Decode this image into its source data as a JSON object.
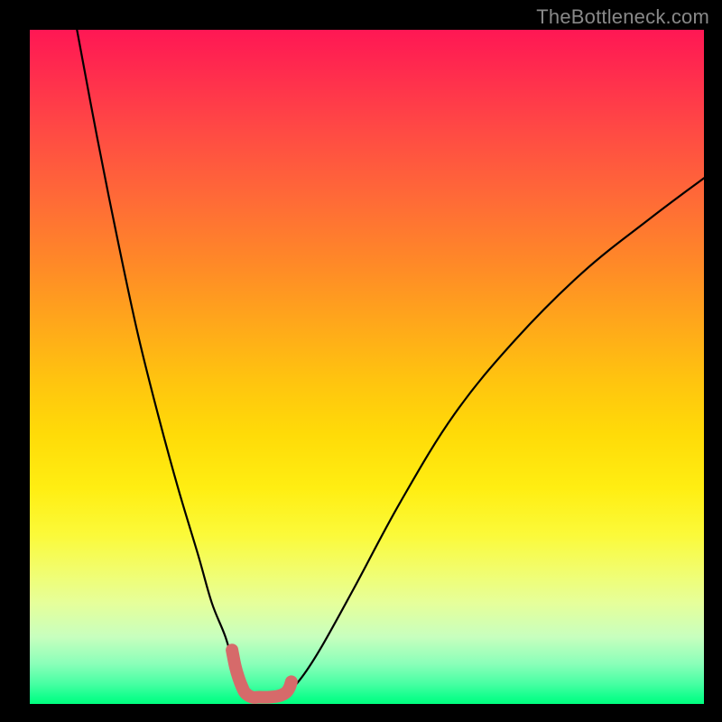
{
  "watermark": "TheBottleneck.com",
  "chart_data": {
    "type": "line",
    "title": "",
    "xlabel": "",
    "ylabel": "",
    "xlim": [
      0,
      100
    ],
    "ylim": [
      0,
      100
    ],
    "series": [
      {
        "name": "bottleneck-curve",
        "x": [
          7,
          10,
          13,
          16,
          19,
          22,
          25,
          27,
          29,
          30.5,
          31.5,
          32.5,
          33,
          34,
          36,
          38,
          40,
          43,
          48,
          55,
          63,
          72,
          82,
          92,
          100
        ],
        "values": [
          100,
          84,
          69,
          55,
          43,
          32,
          22,
          15,
          10,
          5,
          3,
          1.5,
          1,
          1,
          1.2,
          1.7,
          3.5,
          8,
          17,
          30,
          43,
          54,
          64,
          72,
          78
        ]
      },
      {
        "name": "minimum-marker",
        "x": [
          30,
          30.5,
          31,
          31.5,
          32,
          33,
          34,
          35.5,
          37,
          38,
          38.5,
          38.8
        ],
        "values": [
          8,
          5.5,
          3.8,
          2.5,
          1.6,
          1,
          1,
          1,
          1.2,
          1.7,
          2.4,
          3.3
        ]
      }
    ],
    "colors": {
      "curve": "#000000",
      "marker": "#d66a6a"
    }
  }
}
